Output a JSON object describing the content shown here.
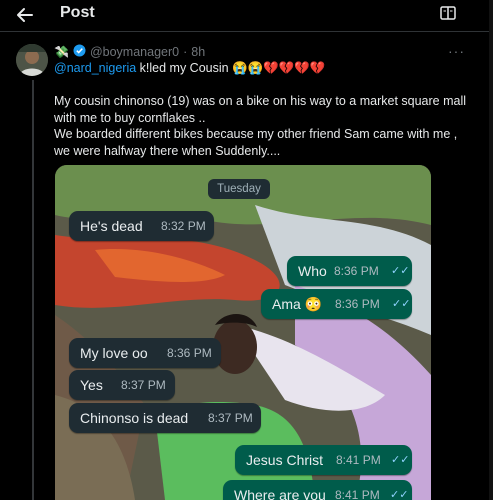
{
  "header": {
    "title": "Post"
  },
  "tweet": {
    "author_handle": "@boymanager0",
    "time_sep": "·",
    "time": "8h",
    "reply_mention": "@nard_nigeria",
    "reply_text": "k!led my Cousin",
    "emojis": "😭😭💔💔💔💔",
    "body_lines": [
      "My cousin chinonso (19) was on a bike on his way to a market square mall",
      "with me to buy cornflakes ..",
      "We boarded different bikes because my other friend Sam came with me ,",
      "we were halfway there when Suddenly...."
    ]
  },
  "chat": {
    "day_label": "Tuesday",
    "messages": [
      {
        "text": "He's dead",
        "time": "8:32 PM",
        "dir": "in"
      },
      {
        "text": "Who",
        "time": "8:36 PM",
        "dir": "out"
      },
      {
        "text": "Ama 😳",
        "time": "8:36 PM",
        "dir": "out"
      },
      {
        "text": "My love oo",
        "time": "8:36 PM",
        "dir": "in"
      },
      {
        "text": "Yes",
        "time": "8:37 PM",
        "dir": "in"
      },
      {
        "text": "Chinonso is dead",
        "time": "8:37 PM",
        "dir": "in"
      },
      {
        "text": "Jesus Christ",
        "time": "8:41 PM",
        "dir": "out"
      },
      {
        "text": "Where are you",
        "time": "8:41 PM",
        "dir": "out"
      }
    ],
    "read_ticks": "✓✓"
  },
  "colors": {
    "accent": "#1d9bf0",
    "incoming_bubble": "#1f2c33",
    "outgoing_bubble": "#005c4b",
    "verified_badge": "#1d9bf0"
  },
  "icons": {
    "back": "arrow-left-icon",
    "reader": "reader-mode-icon",
    "more": "more-dots-icon",
    "verified": "verified-badge-icon",
    "money": "money-wings-emoji"
  }
}
